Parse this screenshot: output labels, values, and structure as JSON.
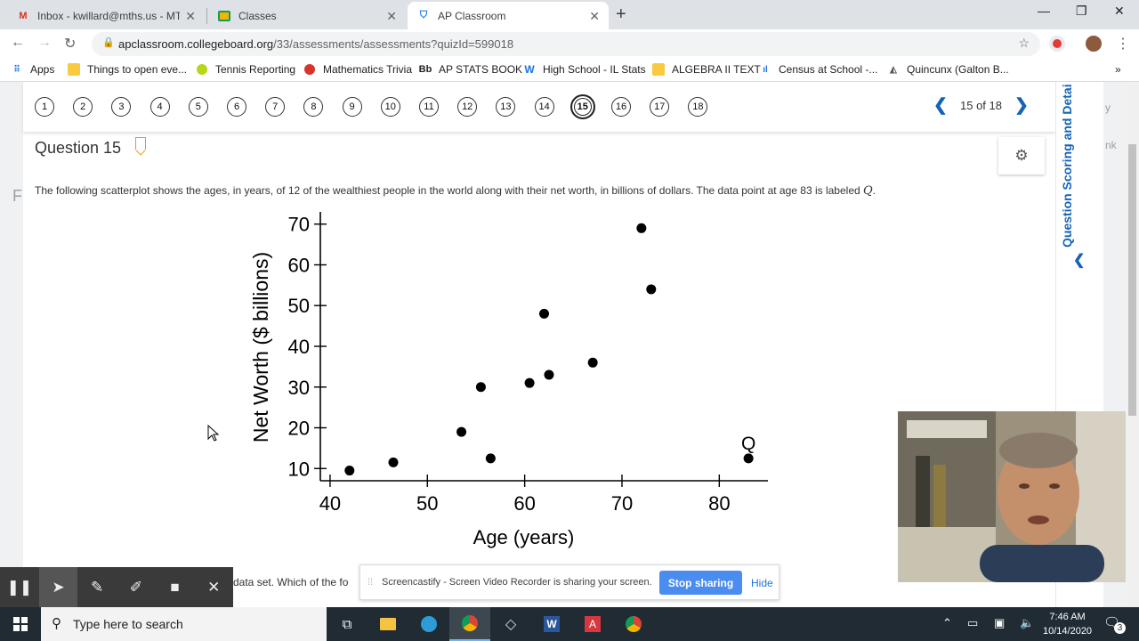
{
  "browser": {
    "tabs": [
      {
        "title": "Inbox - kwillard@mths.us - MTH",
        "icon": "gmail-icon",
        "active": false
      },
      {
        "title": "Classes",
        "icon": "classroom-icon",
        "active": false
      },
      {
        "title": "AP Classroom",
        "icon": "shield-icon",
        "active": true
      }
    ],
    "url_domain": "apclassroom.collegeboard.org",
    "url_path": "/33/assessments/assessments?quizId=599018",
    "bookmarks": [
      "Apps",
      "Things to open eve...",
      "Tennis Reporting",
      "Mathematics Trivia",
      "AP STATS BOOK",
      "High School - IL Stats",
      "ALGEBRA II TEXT",
      "Census at School -...",
      "Quincunx (Galton B..."
    ]
  },
  "quiz": {
    "question_numbers": [
      "1",
      "2",
      "3",
      "4",
      "5",
      "6",
      "7",
      "8",
      "9",
      "10",
      "11",
      "12",
      "13",
      "14",
      "15",
      "16",
      "17",
      "18"
    ],
    "current": "15",
    "pager_text": "15 of 18",
    "question_title": "Question 15",
    "prompt_text": "The following scatterplot shows the ages, in years, of 12 of the wealthiest people in the world along with their net worth, in billions of dollars. The data point at age 83 is labeled ",
    "prompt_var": "Q",
    "prompt_end": ".",
    "partial_line": "data set. Which of the fo",
    "side_panel_title": "Question Scoring and Detai",
    "bg_fragments": [
      "y",
      "nk"
    ]
  },
  "chart_data": {
    "type": "scatter",
    "xlabel": "Age (years)",
    "ylabel": "Net Worth ($ billions)",
    "xlim": [
      39,
      85
    ],
    "ylim": [
      7,
      73
    ],
    "xticks": [
      40,
      50,
      60,
      70,
      80
    ],
    "yticks": [
      10,
      20,
      30,
      40,
      50,
      60,
      70
    ],
    "points": [
      {
        "x": 42,
        "y": 9.5
      },
      {
        "x": 46.5,
        "y": 11.5
      },
      {
        "x": 53.5,
        "y": 19
      },
      {
        "x": 55.5,
        "y": 30
      },
      {
        "x": 56.5,
        "y": 12.5
      },
      {
        "x": 60.5,
        "y": 31
      },
      {
        "x": 62,
        "y": 48
      },
      {
        "x": 62.5,
        "y": 33
      },
      {
        "x": 67,
        "y": 36
      },
      {
        "x": 72,
        "y": 69
      },
      {
        "x": 73,
        "y": 54
      },
      {
        "x": 83,
        "y": 12.5
      }
    ],
    "annotation": {
      "label": "Q",
      "x": 83,
      "y": 12.5
    },
    "grid": false
  },
  "screencastify": {
    "message": "Screencastify - Screen Video Recorder is sharing your screen.",
    "stop_label": "Stop sharing",
    "hide_label": "Hide"
  },
  "taskbar": {
    "search_placeholder": "Type here to search",
    "time": "7:46 AM",
    "date": "10/14/2020",
    "notification_count": "3"
  }
}
